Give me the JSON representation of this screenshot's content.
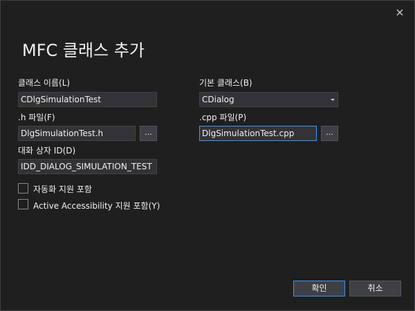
{
  "window": {
    "title": "MFC 클래스 추가"
  },
  "form": {
    "class_name_label": "클래스 이름(L)",
    "class_name_value": "CDlgSimulationTest",
    "base_class_label": "기본 클래스(B)",
    "base_class_value": "CDialog",
    "h_file_label": ".h 파일(F)",
    "h_file_value": "DlgSimulationTest.h",
    "cpp_file_label": ".cpp 파일(P)",
    "cpp_file_value": "DlgSimulationTest.cpp",
    "browse_label": "...",
    "dialog_id_label": "대화 상자 ID(D)",
    "dialog_id_value": "IDD_DIALOG_SIMULATION_TEST",
    "automation_label": "자동화 지원 포함",
    "accessibility_label": "Active Accessibility 지원 포함(Y)"
  },
  "buttons": {
    "ok_label": "확인",
    "cancel_label": "취소"
  },
  "icons": {
    "close": "close-icon",
    "dropdown": "chevron-down-icon"
  },
  "colors": {
    "background": "#1f1f1f",
    "field_bg": "#333337",
    "accent": "#3399ff"
  }
}
